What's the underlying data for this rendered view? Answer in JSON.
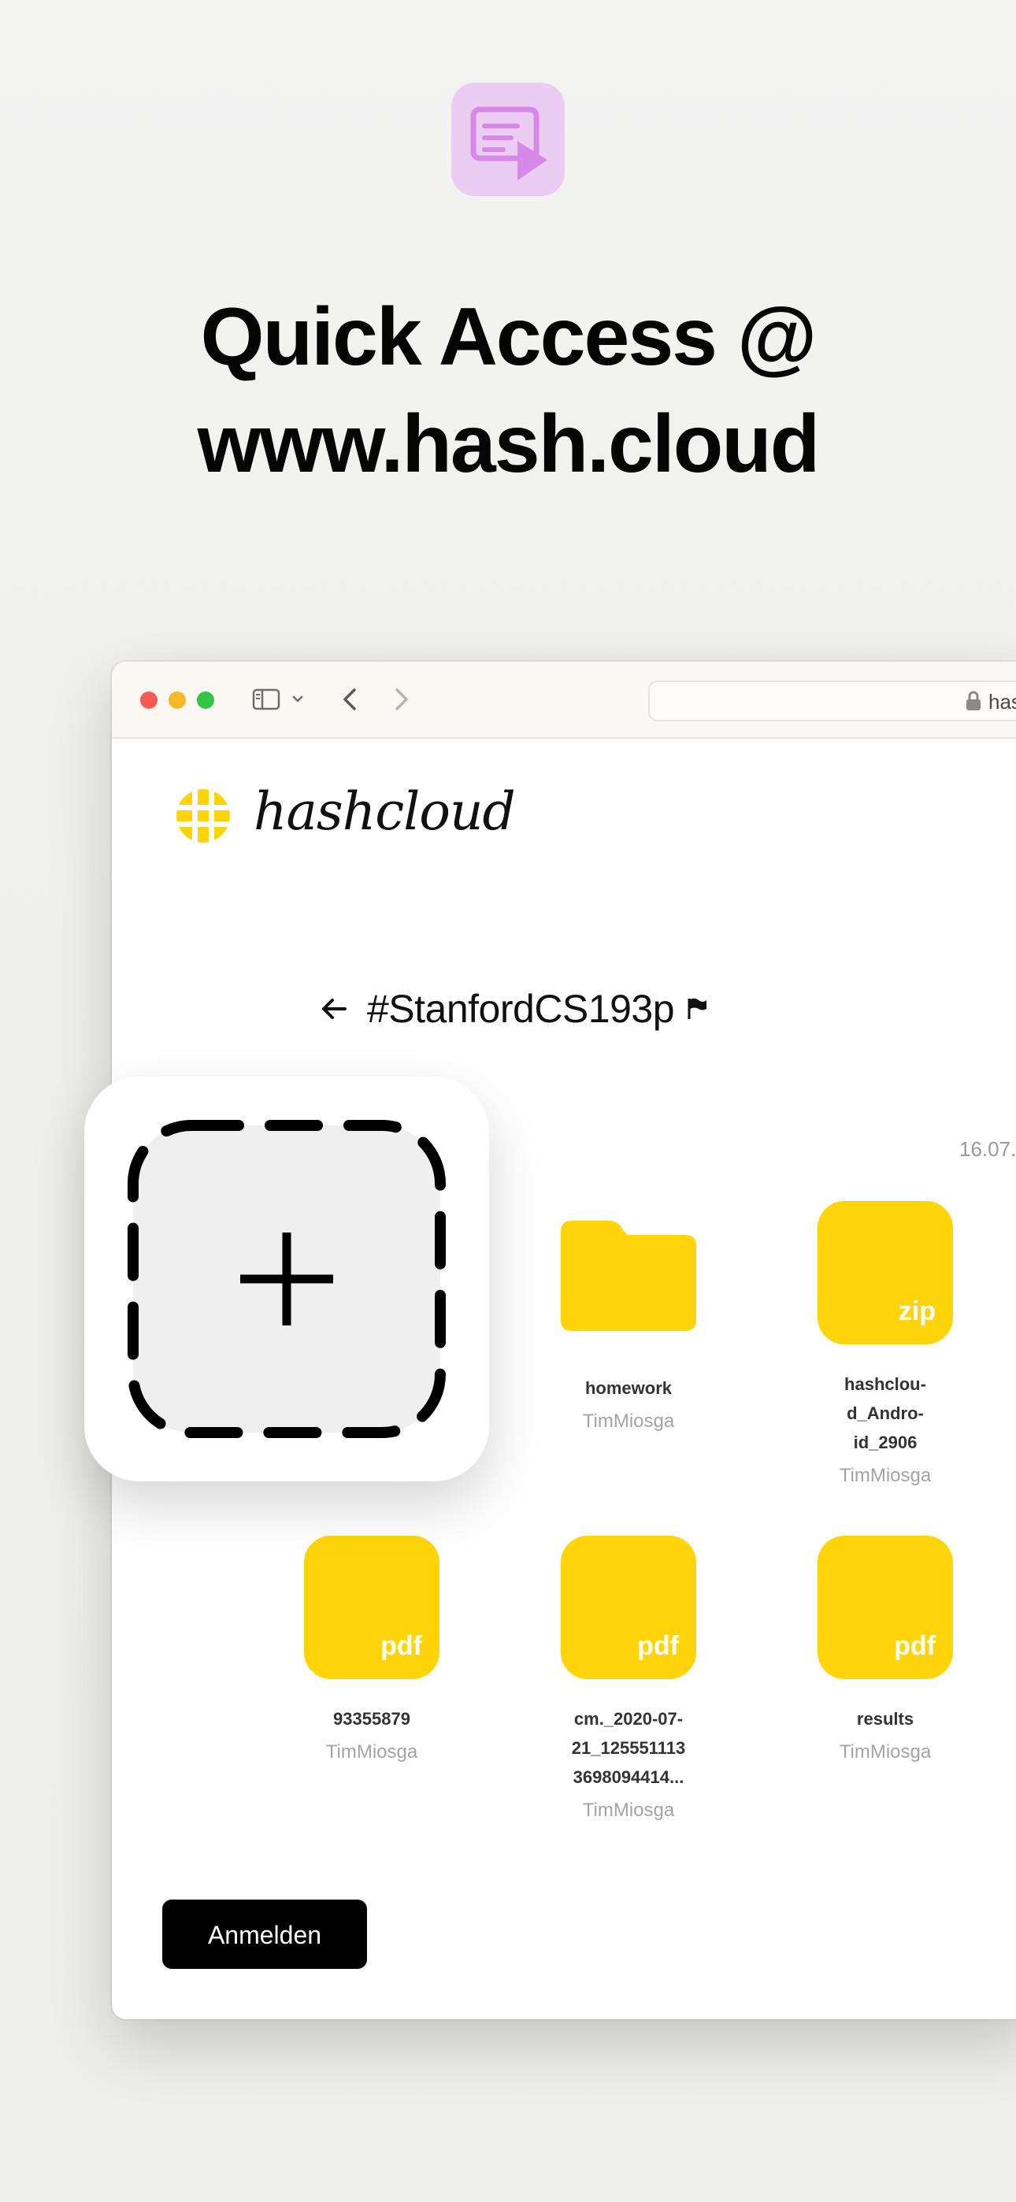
{
  "promo": {
    "icon": "message-play-icon",
    "headline_line1": "Quick Access @",
    "headline_line2": "www.hash.cloud",
    "accent_color": "#ebcdf3"
  },
  "browser": {
    "address_text": "hash",
    "traffic_lights": [
      "#f25c54",
      "#f6b928",
      "#34c548"
    ]
  },
  "page": {
    "logo_text": "hashcloud",
    "folder_title": "#StanfordCS193p",
    "date": "16.07.",
    "brand_color": "#ffd50a",
    "files": [
      {
        "name": "homework",
        "owner": "TimMiosga",
        "kind": "folder",
        "ext": ""
      },
      {
        "name": "hashclou-\nd_Andro-\nid_2906",
        "owner": "TimMiosga",
        "kind": "file",
        "ext": "zip"
      },
      {
        "name": "93355879",
        "owner": "TimMiosga",
        "kind": "file",
        "ext": "pdf"
      },
      {
        "name": "cm._2020-07-\n21_125551113\n3698094414...",
        "owner": "TimMiosga",
        "kind": "file",
        "ext": "pdf"
      },
      {
        "name": "results",
        "owner": "TimMiosga",
        "kind": "file",
        "ext": "pdf"
      }
    ],
    "login_label": "Anmelden"
  },
  "overlay": {
    "icon": "add-icon"
  }
}
